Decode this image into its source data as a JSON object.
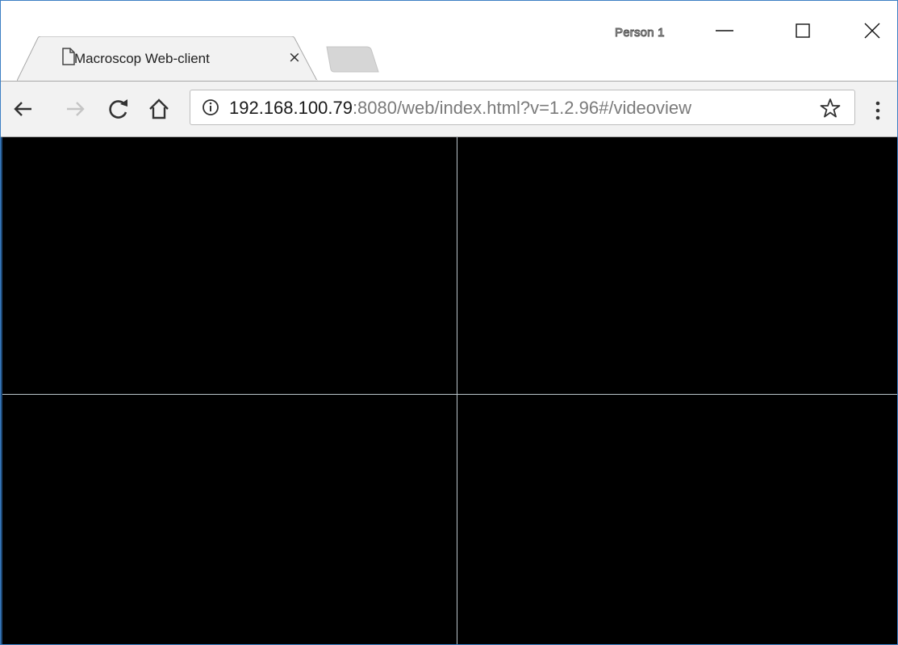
{
  "browser": {
    "tab": {
      "title": "Macroscop Web-client",
      "close_glyph": "×",
      "icon": "page-icon"
    },
    "profile": {
      "name": "Person 1"
    },
    "window_controls": {
      "minimize": "minimize-icon",
      "maximize": "maximize-icon",
      "close": "close-icon"
    }
  },
  "toolbar": {
    "url_host": "192.168.100.79",
    "url_rest": ":8080/web/index.html?v=1.2.96#/videoview",
    "icons": [
      "back-arrow-icon",
      "forward-arrow-icon",
      "reload-icon",
      "home-icon",
      "info-icon",
      "bookmark-star-icon",
      "menu-dots-icon"
    ]
  },
  "viewport": {
    "layout": "2x2 camera grid",
    "cells": [
      {
        "name": "camera-cell-1"
      },
      {
        "name": "camera-cell-2"
      },
      {
        "name": "camera-cell-3"
      },
      {
        "name": "camera-cell-4"
      }
    ]
  },
  "colors": {
    "window_border": "#3d7fc4",
    "video_background": "#000000",
    "grid_divider": "#b9c4c9",
    "url_host": "#1a1a1a",
    "url_path": "#7b7b7b"
  }
}
